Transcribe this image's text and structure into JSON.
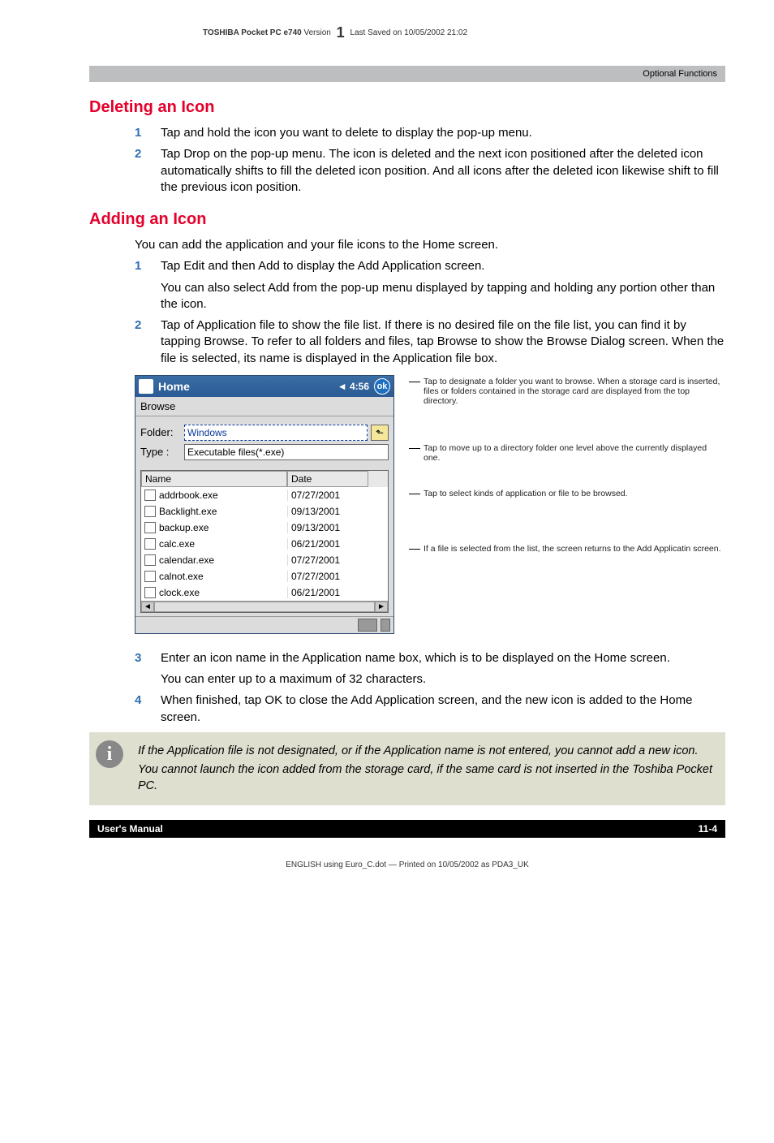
{
  "top_header": {
    "product": "TOSHIBA Pocket PC e740",
    "version_label": "Version",
    "version_num": "1",
    "saved": "Last Saved on 10/05/2002 21:02"
  },
  "section_banner": "Optional Functions",
  "deleting": {
    "title": "Deleting an Icon",
    "items": [
      {
        "num": "1",
        "text": "Tap and hold the icon you want to delete to display the pop-up menu."
      },
      {
        "num": "2",
        "text": "Tap Drop on the pop-up menu. The icon is deleted and the next icon positioned after the deleted icon automatically shifts to fill the deleted icon position. And all icons after the deleted icon likewise shift to fill the previous icon position."
      }
    ]
  },
  "adding": {
    "title": "Adding an Icon",
    "intro": "You can add the application and your file icons to the Home screen.",
    "items": [
      {
        "num": "1",
        "text": "Tap Edit and then Add to display the Add Application screen.",
        "extra": "You can also select Add from the pop-up menu displayed by tapping and holding any portion other than the icon."
      },
      {
        "num": "2",
        "text": "Tap   of Application file to show the file list. If there is no desired file on the file list, you can find it by tapping Browse. To refer to all folders and files, tap Browse to show the Browse Dialog screen. When the file is selected, its name is displayed in the Application file box."
      },
      {
        "num": "3",
        "text": "Enter an icon name in the Application name box, which is to be displayed on the Home screen.",
        "extra": "You can enter up to a maximum of 32 characters."
      },
      {
        "num": "4",
        "text": "When finished, tap OK to close the Add Application screen, and the new icon is added to the Home screen."
      }
    ]
  },
  "screenshot": {
    "title": "Home",
    "speaker": "◄",
    "time": "4:56",
    "ok": "ok",
    "browse_label": "Browse",
    "folder_label": "Folder:",
    "folder_value": "Windows",
    "type_label": "Type :",
    "type_value": "Executable files(*.exe)",
    "col_name": "Name",
    "col_date": "Date",
    "files": [
      {
        "icon": "file",
        "name": "addrbook.exe",
        "date": "07/27/2001"
      },
      {
        "icon": "gear",
        "name": "Backlight.exe",
        "date": "09/13/2001"
      },
      {
        "icon": "disk",
        "name": "backup.exe",
        "date": "09/13/2001"
      },
      {
        "icon": "calc",
        "name": "calc.exe",
        "date": "06/21/2001"
      },
      {
        "icon": "file",
        "name": "calendar.exe",
        "date": "07/27/2001"
      },
      {
        "icon": "file",
        "name": "calnot.exe",
        "date": "07/27/2001"
      },
      {
        "icon": "file",
        "name": "clock.exe",
        "date": "06/21/2001"
      }
    ]
  },
  "annotations": {
    "a1": "Tap to designate a folder you want to browse. When a storage card is inserted, files or folders contained in the storage card are displayed from the top directory.",
    "a2": "Tap to move up to a directory folder one level above the currently displayed one.",
    "a3": "Tap to select kinds of application or file to be browsed.",
    "a4": "If a file is selected from the list, the screen returns to the Add Applicatin screen."
  },
  "note": {
    "p1": "If the Application file is not designated, or if the Application name is not entered, you cannot add a new icon.",
    "p2": "You cannot launch the icon added from the storage card, if the same card is not inserted in the Toshiba Pocket PC."
  },
  "footer": {
    "left": "User's Manual",
    "right": "11-4"
  },
  "footer_printinfo": "ENGLISH using  Euro_C.dot — Printed on 10/05/2002 as PDA3_UK"
}
